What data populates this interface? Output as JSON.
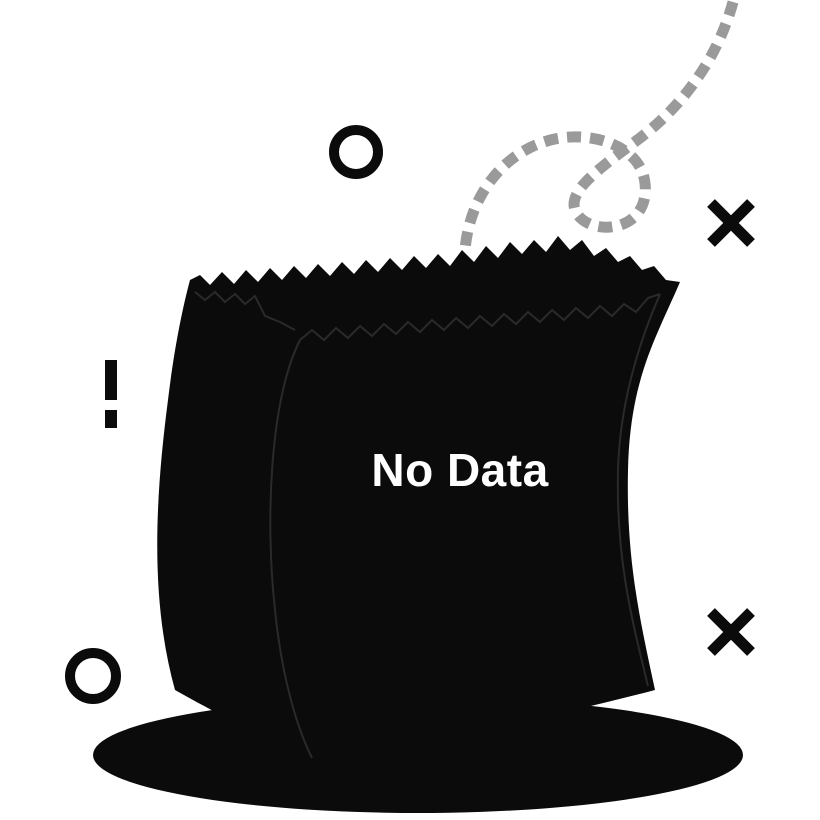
{
  "empty_state": {
    "message": "No Data",
    "illustration": "empty-paper-bag",
    "colors": {
      "bag": "#0b0b0b",
      "shadow": "#0b0b0b",
      "dotted_trail": "#9a9a9a",
      "text": "#ffffff",
      "background": "#ffffff"
    },
    "decorations": [
      "circle-icon",
      "circle-icon",
      "x-mark-icon",
      "x-mark-icon",
      "exclamation-icon",
      "dotted-trail"
    ]
  }
}
